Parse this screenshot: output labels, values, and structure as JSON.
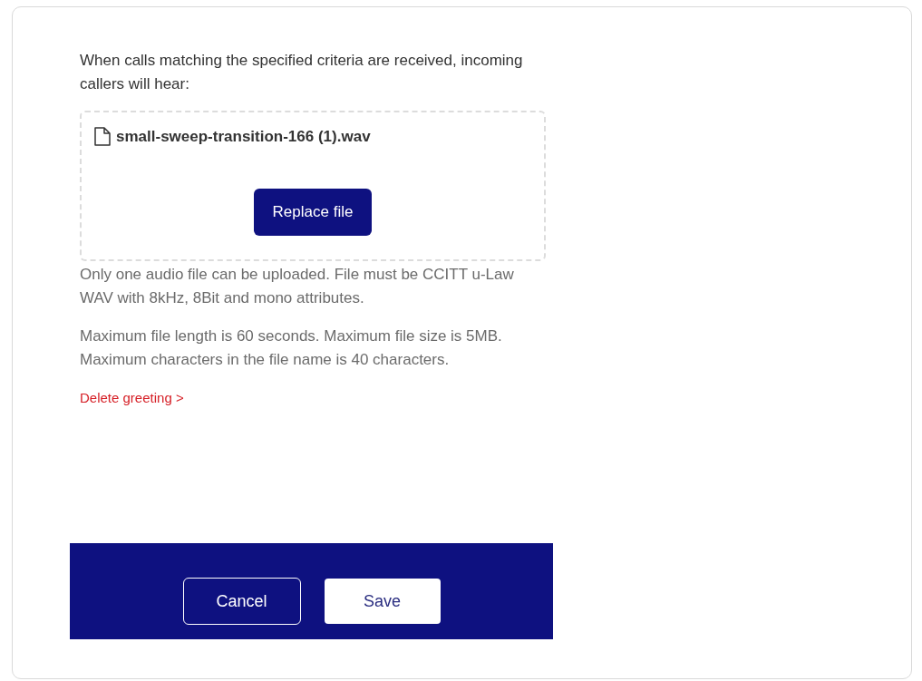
{
  "intro": "When calls matching the specified criteria are received, incoming callers will hear:",
  "upload": {
    "file_name": "small-sweep-transition-166 (1).wav",
    "button": "Replace file"
  },
  "notes": [
    "Only one audio file can be uploaded. File must be CCITT u-Law WAV with 8kHz, 8Bit and mono attributes.",
    "Maximum file length is 60 seconds. Maximum file size is 5MB. Maximum characters in the file name is 40 characters."
  ],
  "delete_link": {
    "label": "Delete greeting",
    "chevron": ">"
  },
  "footer_buttons": [
    {
      "label": "Cancel",
      "kind": "outline"
    },
    {
      "label": "Save",
      "kind": "filled"
    }
  ]
}
